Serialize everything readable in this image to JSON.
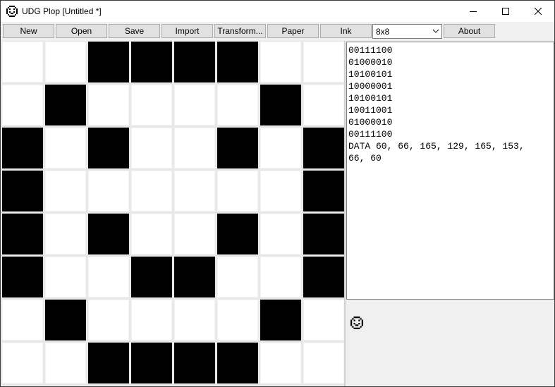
{
  "window": {
    "title": "UDG Plop [Untitled *]"
  },
  "toolbar": {
    "buttons": [
      "New",
      "Open",
      "Save",
      "Import",
      "Transform...",
      "Paper",
      "Ink"
    ],
    "size_select": {
      "value": "8x8"
    },
    "about": "About"
  },
  "grid": {
    "rows": [
      "00111100",
      "01000010",
      "10100101",
      "10000001",
      "10100101",
      "10011001",
      "01000010",
      "00111100"
    ]
  },
  "output": {
    "lines": [
      "00111100",
      "01000010",
      "10100101",
      "10000001",
      "10100101",
      "10011001",
      "01000010",
      "00111100",
      "DATA 60, 66, 165, 129, 165, 153,",
      "66, 60"
    ]
  },
  "preview": {
    "icon": "smiley-preview-icon"
  }
}
